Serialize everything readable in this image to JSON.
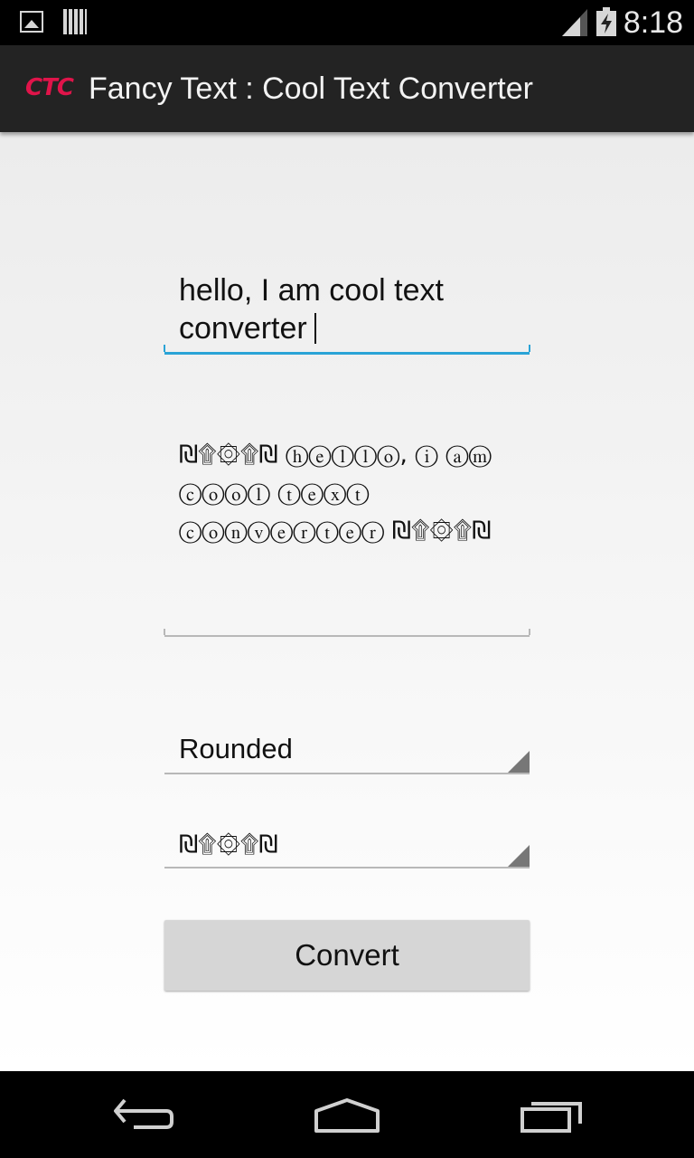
{
  "status_bar": {
    "time": "8:18",
    "icons": [
      "gallery-icon",
      "barcode-icon",
      "signal-icon",
      "battery-charging-icon"
    ]
  },
  "action_bar": {
    "logo": "CTC",
    "title": "Fancy Text : Cool Text Converter"
  },
  "main": {
    "input_value": "hello, I am cool text converter",
    "output_value": "₪۩۞۩₪ ⓗⓔⓛⓛⓞ, ⓘ ⓐⓜ ⓒⓞⓞⓛ ⓣⓔⓧⓣ ⓒⓞⓝⓥⓔⓡⓣⓔⓡ ₪۩۞۩₪",
    "style_selected": "Rounded",
    "decoration_selected": "₪۩۞۩₪",
    "convert_label": "Convert"
  },
  "nav_bar": {
    "icons": [
      "back-icon",
      "home-icon",
      "recent-apps-icon"
    ]
  },
  "colors": {
    "accent": "#2aa3d6",
    "logo": "#e0144a",
    "action_bar_bg": "#232323",
    "button_bg": "#d6d6d6"
  }
}
